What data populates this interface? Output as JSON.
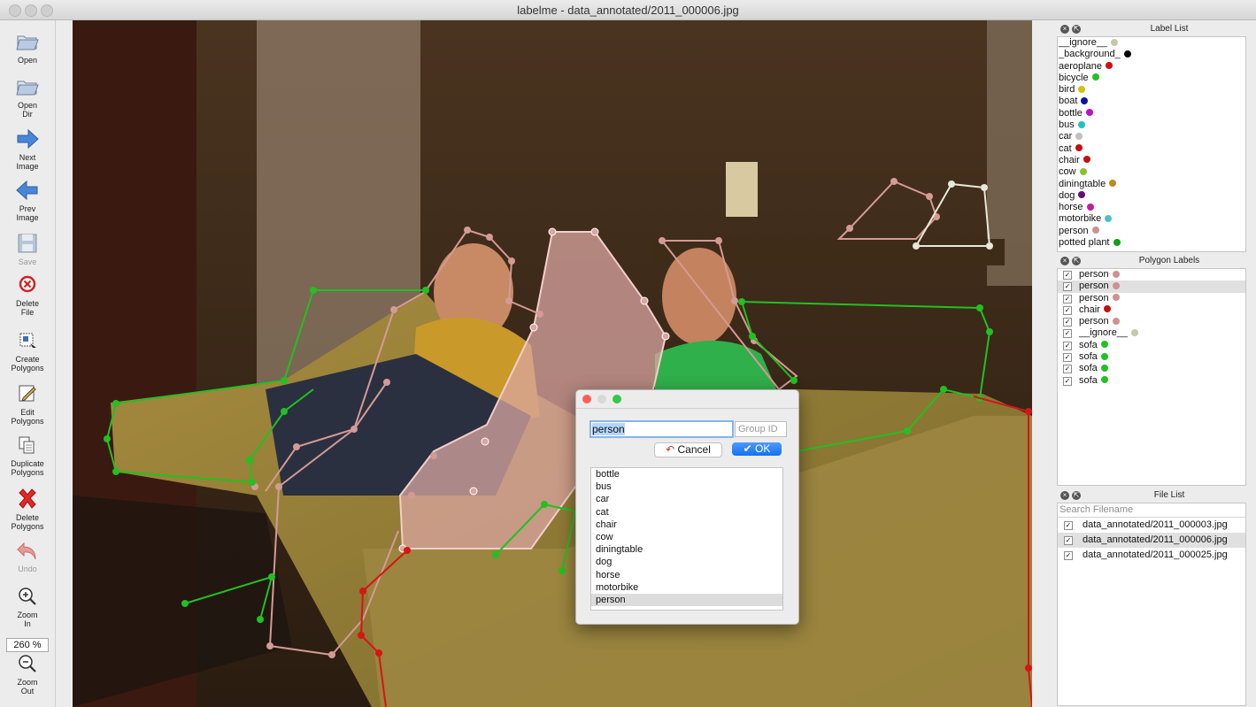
{
  "window": {
    "title": "labelme - data_annotated/2011_000006.jpg"
  },
  "toolbar": {
    "items": [
      {
        "label": "Open",
        "icon": "folder-icon"
      },
      {
        "label": "Open\nDir",
        "icon": "folder-icon"
      },
      {
        "label": "Next\nImage",
        "icon": "arrow-right-icon"
      },
      {
        "label": "Prev\nImage",
        "icon": "arrow-left-icon"
      },
      {
        "label": "Save",
        "icon": "floppy-disk-icon"
      },
      {
        "label": "Delete\nFile",
        "icon": "delete-circle-icon"
      },
      {
        "label": "Create\nPolygons",
        "icon": "create-polygon-icon"
      },
      {
        "label": "Edit\nPolygons",
        "icon": "pencil-icon"
      },
      {
        "label": "Duplicate\nPolygons",
        "icon": "duplicate-icon"
      },
      {
        "label": "Delete\nPolygons",
        "icon": "red-x-icon"
      },
      {
        "label": "Undo",
        "icon": "undo-icon"
      },
      {
        "label": "Zoom\nIn",
        "icon": "zoom-in-icon"
      },
      {
        "label": "Zoom\nOut",
        "icon": "zoom-out-icon"
      }
    ],
    "zoom_value": "260 %"
  },
  "dialog": {
    "label_value": "person",
    "group_id_placeholder": "Group ID",
    "cancel_label": "Cancel",
    "ok_label": "OK",
    "labels": [
      "bottle",
      "bus",
      "car",
      "cat",
      "chair",
      "cow",
      "diningtable",
      "dog",
      "horse",
      "motorbike",
      "person"
    ],
    "selected": "person"
  },
  "label_list": {
    "title": "Label List",
    "items": [
      {
        "name": "__ignore__",
        "color": "#c8c8a8"
      },
      {
        "name": "_background_",
        "color": "#000000"
      },
      {
        "name": "aeroplane",
        "color": "#d01010"
      },
      {
        "name": "bicycle",
        "color": "#22c022"
      },
      {
        "name": "bird",
        "color": "#d0c010"
      },
      {
        "name": "boat",
        "color": "#1010a0"
      },
      {
        "name": "bottle",
        "color": "#c010c0"
      },
      {
        "name": "bus",
        "color": "#20c0c0"
      },
      {
        "name": "car",
        "color": "#c0c0c0"
      },
      {
        "name": "cat",
        "color": "#c01010"
      },
      {
        "name": "chair",
        "color": "#c01010"
      },
      {
        "name": "cow",
        "color": "#8cc030"
      },
      {
        "name": "diningtable",
        "color": "#c08a20"
      },
      {
        "name": "dog",
        "color": "#601070"
      },
      {
        "name": "horse",
        "color": "#c020a0"
      },
      {
        "name": "motorbike",
        "color": "#50c0c0"
      },
      {
        "name": "person",
        "color": "#d09090"
      },
      {
        "name": "potted plant",
        "color": "#10a010"
      }
    ]
  },
  "polygon_labels": {
    "title": "Polygon Labels",
    "items": [
      {
        "name": "person",
        "color": "#d09090"
      },
      {
        "name": "person",
        "color": "#d09090"
      },
      {
        "name": "person",
        "color": "#d09090"
      },
      {
        "name": "chair",
        "color": "#c01010"
      },
      {
        "name": "person",
        "color": "#d09090"
      },
      {
        "name": "__ignore__",
        "color": "#c8c8a8"
      },
      {
        "name": "sofa",
        "color": "#22c022"
      },
      {
        "name": "sofa",
        "color": "#22c022"
      },
      {
        "name": "sofa",
        "color": "#22c022"
      },
      {
        "name": "sofa",
        "color": "#22c022"
      }
    ]
  },
  "file_list": {
    "title": "File List",
    "search_placeholder": "Search Filename",
    "items": [
      "data_annotated/2011_000003.jpg",
      "data_annotated/2011_000006.jpg",
      "data_annotated/2011_000025.jpg"
    ]
  }
}
